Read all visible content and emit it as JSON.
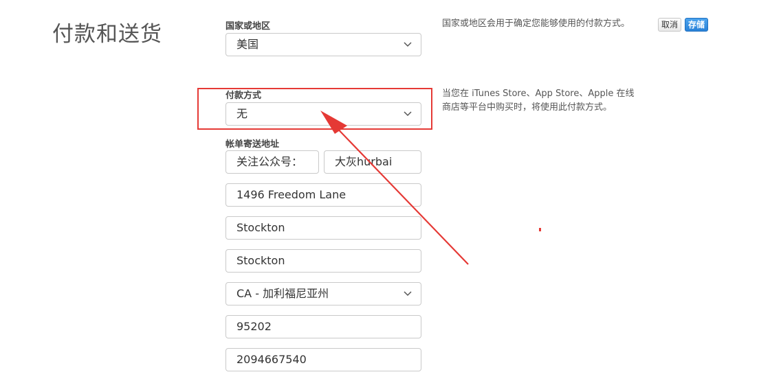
{
  "page": {
    "title": "付款和送货"
  },
  "actions": {
    "cancel_label": "取消",
    "save_label": "存储"
  },
  "country": {
    "label": "国家或地区",
    "value": "美国",
    "note": "国家或地区会用于确定您能够使用的付款方式。"
  },
  "payment": {
    "label": "付款方式",
    "value": "无",
    "note": "当您在 iTunes Store、App Store、Apple 在线商店等平台中购买时，将使用此付款方式。"
  },
  "billing": {
    "label": "帐单寄送地址",
    "first_name": "关注公众号：",
    "last_name": "大灰hurbai",
    "street": "1496 Freedom Lane",
    "city": "Stockton",
    "city2": "Stockton",
    "state": "CA - 加利福尼亚州",
    "zip": "95202",
    "phone": "2094667540"
  },
  "annotation": {
    "color": "#e53935"
  },
  "icons": {
    "dropdown": "chevron-down-icon"
  }
}
